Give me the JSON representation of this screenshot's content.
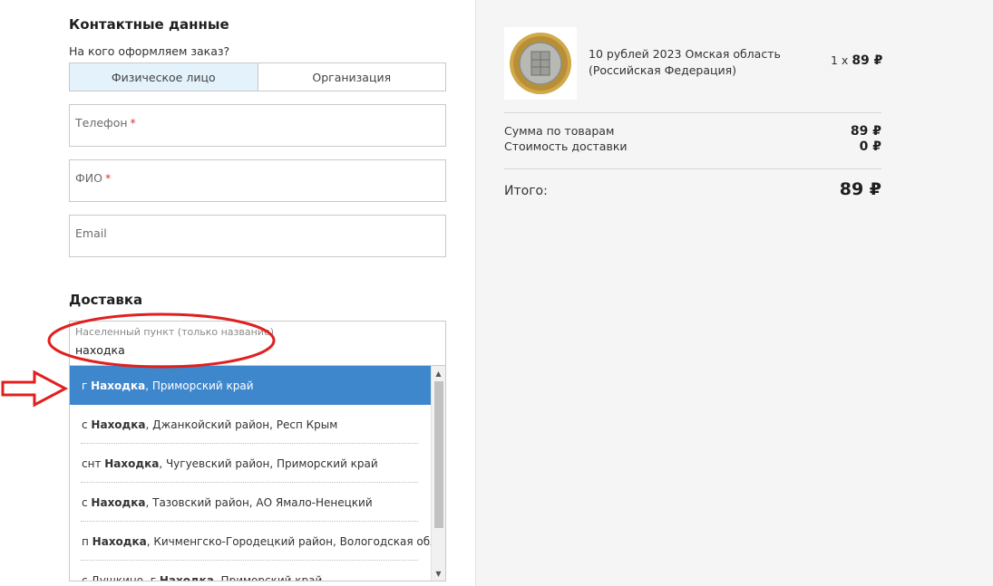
{
  "contacts": {
    "title": "Контактные данные",
    "question": "На кого оформляем заказ?",
    "types": [
      "Физическое лицо",
      "Организация"
    ],
    "phone_label": "Телефон",
    "name_label": "ФИО",
    "email_label": "Email",
    "required_mark": "*"
  },
  "delivery": {
    "title": "Доставка",
    "city_label": "Населенный пункт (только название)",
    "city_value": "находка",
    "suggestions": [
      {
        "prefix": "г ",
        "match": "Находка",
        "rest": ", Приморский край"
      },
      {
        "prefix": "с ",
        "match": "Находка",
        "rest": ", Джанкойский район, Респ Крым"
      },
      {
        "prefix": "снт ",
        "match": "Находка",
        "rest": ", Чугуевский район, Приморский край"
      },
      {
        "prefix": "с ",
        "match": "Находка",
        "rest": ", Тазовский район, АО Ямало-Ненецкий"
      },
      {
        "prefix": "п ",
        "match": "Находка",
        "rest": ", Кичменгско-Городецкий район, Вологодская обл."
      },
      {
        "prefix": "с Душкино, г ",
        "match": "Находка",
        "rest": ", Приморский край"
      }
    ]
  },
  "order": {
    "product_name": "10 рублей 2023 Омская область (Российская Федерация)",
    "qty": "1 х",
    "price": "89 ₽",
    "subtotal_label": "Сумма по товарам",
    "subtotal_value": "89 ₽",
    "shipping_label": "Стоимость доставки",
    "shipping_value": "0 ₽",
    "total_label": "Итого:",
    "total_value": "89 ₽"
  },
  "annotation_color": "#e02020",
  "accent_color": "#3f87cc",
  "icons": {
    "scroll_up": "▲",
    "scroll_down": "▼"
  }
}
